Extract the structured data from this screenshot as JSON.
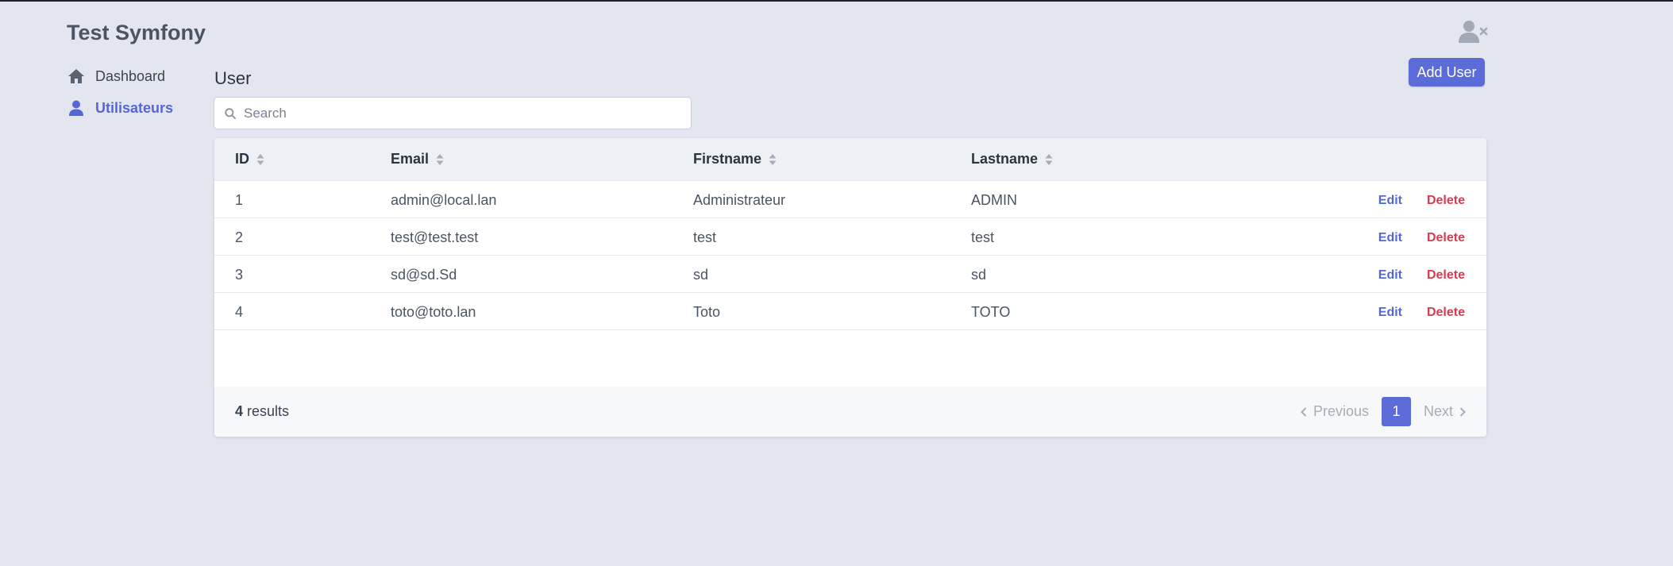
{
  "app": {
    "title": "Test Symfony"
  },
  "sidebar": {
    "items": [
      {
        "label": "Dashboard",
        "icon": "home-icon",
        "active": false
      },
      {
        "label": "Utilisateurs",
        "icon": "user-icon",
        "active": true
      }
    ]
  },
  "header": {
    "logout_icon": "user-times-icon"
  },
  "main": {
    "title": "User",
    "add_button": "Add User",
    "search": {
      "placeholder": "Search",
      "value": ""
    },
    "table": {
      "columns": [
        "ID",
        "Email",
        "Firstname",
        "Lastname"
      ],
      "rows": [
        {
          "id": "1",
          "email": "admin@local.lan",
          "firstname": "Administrateur",
          "lastname": "ADMIN"
        },
        {
          "id": "2",
          "email": "test@test.test",
          "firstname": "test",
          "lastname": "test"
        },
        {
          "id": "3",
          "email": "sd@sd.Sd",
          "firstname": "sd",
          "lastname": "sd"
        },
        {
          "id": "4",
          "email": "toto@toto.lan",
          "firstname": "Toto",
          "lastname": "TOTO"
        }
      ],
      "actions": {
        "edit": "Edit",
        "delete": "Delete"
      }
    },
    "footer": {
      "count": "4",
      "results_label": "results",
      "pagination": {
        "previous": "Previous",
        "current_page": "1",
        "next": "Next"
      }
    }
  },
  "colors": {
    "accent": "#5b6cd8",
    "danger": "#d83a4f",
    "background": "#e3e6ee"
  }
}
